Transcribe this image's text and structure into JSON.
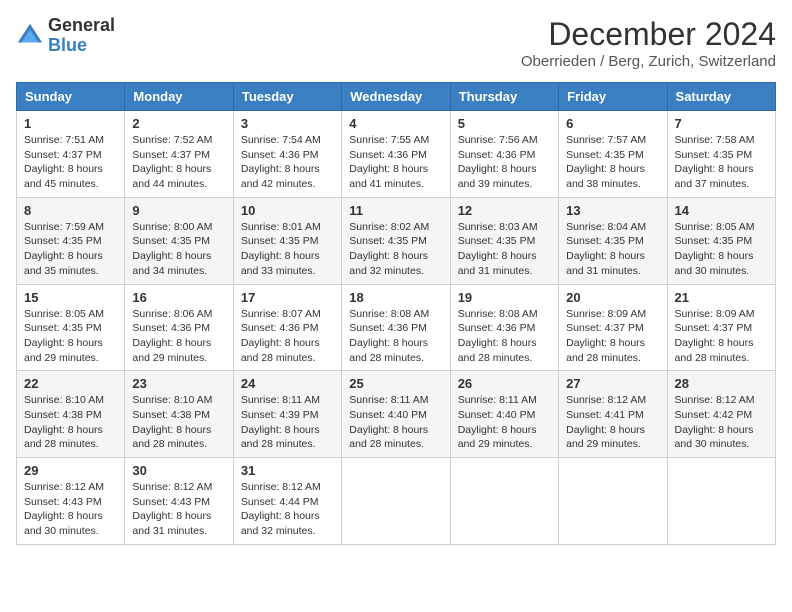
{
  "header": {
    "logo_general": "General",
    "logo_blue": "Blue",
    "month_title": "December 2024",
    "location": "Oberrieden / Berg, Zurich, Switzerland"
  },
  "days_of_week": [
    "Sunday",
    "Monday",
    "Tuesday",
    "Wednesday",
    "Thursday",
    "Friday",
    "Saturday"
  ],
  "weeks": [
    [
      {
        "day": "1",
        "sunrise": "7:51 AM",
        "sunset": "4:37 PM",
        "daylight": "8 hours and 45 minutes."
      },
      {
        "day": "2",
        "sunrise": "7:52 AM",
        "sunset": "4:37 PM",
        "daylight": "8 hours and 44 minutes."
      },
      {
        "day": "3",
        "sunrise": "7:54 AM",
        "sunset": "4:36 PM",
        "daylight": "8 hours and 42 minutes."
      },
      {
        "day": "4",
        "sunrise": "7:55 AM",
        "sunset": "4:36 PM",
        "daylight": "8 hours and 41 minutes."
      },
      {
        "day": "5",
        "sunrise": "7:56 AM",
        "sunset": "4:36 PM",
        "daylight": "8 hours and 39 minutes."
      },
      {
        "day": "6",
        "sunrise": "7:57 AM",
        "sunset": "4:35 PM",
        "daylight": "8 hours and 38 minutes."
      },
      {
        "day": "7",
        "sunrise": "7:58 AM",
        "sunset": "4:35 PM",
        "daylight": "8 hours and 37 minutes."
      }
    ],
    [
      {
        "day": "8",
        "sunrise": "7:59 AM",
        "sunset": "4:35 PM",
        "daylight": "8 hours and 35 minutes."
      },
      {
        "day": "9",
        "sunrise": "8:00 AM",
        "sunset": "4:35 PM",
        "daylight": "8 hours and 34 minutes."
      },
      {
        "day": "10",
        "sunrise": "8:01 AM",
        "sunset": "4:35 PM",
        "daylight": "8 hours and 33 minutes."
      },
      {
        "day": "11",
        "sunrise": "8:02 AM",
        "sunset": "4:35 PM",
        "daylight": "8 hours and 32 minutes."
      },
      {
        "day": "12",
        "sunrise": "8:03 AM",
        "sunset": "4:35 PM",
        "daylight": "8 hours and 31 minutes."
      },
      {
        "day": "13",
        "sunrise": "8:04 AM",
        "sunset": "4:35 PM",
        "daylight": "8 hours and 31 minutes."
      },
      {
        "day": "14",
        "sunrise": "8:05 AM",
        "sunset": "4:35 PM",
        "daylight": "8 hours and 30 minutes."
      }
    ],
    [
      {
        "day": "15",
        "sunrise": "8:05 AM",
        "sunset": "4:35 PM",
        "daylight": "8 hours and 29 minutes."
      },
      {
        "day": "16",
        "sunrise": "8:06 AM",
        "sunset": "4:36 PM",
        "daylight": "8 hours and 29 minutes."
      },
      {
        "day": "17",
        "sunrise": "8:07 AM",
        "sunset": "4:36 PM",
        "daylight": "8 hours and 28 minutes."
      },
      {
        "day": "18",
        "sunrise": "8:08 AM",
        "sunset": "4:36 PM",
        "daylight": "8 hours and 28 minutes."
      },
      {
        "day": "19",
        "sunrise": "8:08 AM",
        "sunset": "4:36 PM",
        "daylight": "8 hours and 28 minutes."
      },
      {
        "day": "20",
        "sunrise": "8:09 AM",
        "sunset": "4:37 PM",
        "daylight": "8 hours and 28 minutes."
      },
      {
        "day": "21",
        "sunrise": "8:09 AM",
        "sunset": "4:37 PM",
        "daylight": "8 hours and 28 minutes."
      }
    ],
    [
      {
        "day": "22",
        "sunrise": "8:10 AM",
        "sunset": "4:38 PM",
        "daylight": "8 hours and 28 minutes."
      },
      {
        "day": "23",
        "sunrise": "8:10 AM",
        "sunset": "4:38 PM",
        "daylight": "8 hours and 28 minutes."
      },
      {
        "day": "24",
        "sunrise": "8:11 AM",
        "sunset": "4:39 PM",
        "daylight": "8 hours and 28 minutes."
      },
      {
        "day": "25",
        "sunrise": "8:11 AM",
        "sunset": "4:40 PM",
        "daylight": "8 hours and 28 minutes."
      },
      {
        "day": "26",
        "sunrise": "8:11 AM",
        "sunset": "4:40 PM",
        "daylight": "8 hours and 29 minutes."
      },
      {
        "day": "27",
        "sunrise": "8:12 AM",
        "sunset": "4:41 PM",
        "daylight": "8 hours and 29 minutes."
      },
      {
        "day": "28",
        "sunrise": "8:12 AM",
        "sunset": "4:42 PM",
        "daylight": "8 hours and 30 minutes."
      }
    ],
    [
      {
        "day": "29",
        "sunrise": "8:12 AM",
        "sunset": "4:43 PM",
        "daylight": "8 hours and 30 minutes."
      },
      {
        "day": "30",
        "sunrise": "8:12 AM",
        "sunset": "4:43 PM",
        "daylight": "8 hours and 31 minutes."
      },
      {
        "day": "31",
        "sunrise": "8:12 AM",
        "sunset": "4:44 PM",
        "daylight": "8 hours and 32 minutes."
      },
      null,
      null,
      null,
      null
    ]
  ],
  "labels": {
    "sunrise": "Sunrise:",
    "sunset": "Sunset:",
    "daylight": "Daylight:"
  }
}
